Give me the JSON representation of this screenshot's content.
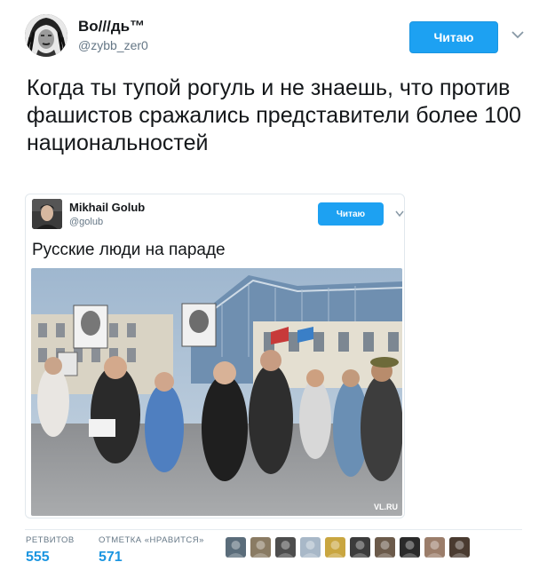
{
  "author": {
    "name": "Во///дь™",
    "handle": "@zybb_zer0",
    "avatar_icon": "warrior-headdress-portrait"
  },
  "follow_button_label": "Читаю",
  "tweet_text": "Когда ты тупой рогуль и не знаешь, что против фашистов сражались представители более 100 национальностей",
  "quoted_tweet": {
    "name": "Mikhail Golub",
    "handle": "@golub",
    "follow_label": "Читаю",
    "text": "Русские люди на параде",
    "photo_watermark": "VL.RU",
    "photo_description": "parade-crowd-holding-portraits"
  },
  "stats": {
    "retweets_label": "РЕТВИТОВ",
    "retweets_value": "555",
    "likes_label": "ОТМЕТКА «НРАВИТСЯ»",
    "likes_value": "571"
  },
  "likers": [
    {
      "color": "#5a6c7a"
    },
    {
      "color": "#8a7b63"
    },
    {
      "color": "#4d4d4d"
    },
    {
      "color": "#a8b8c8"
    },
    {
      "color": "#c9a640"
    },
    {
      "color": "#3c3c3c"
    },
    {
      "color": "#6b5a4a"
    },
    {
      "color": "#2a2a2a"
    },
    {
      "color": "#9b7d6a"
    },
    {
      "color": "#4a3b30"
    }
  ],
  "colors": {
    "accent": "#1da1f2",
    "link": "#1b95e0",
    "muted": "#657786"
  }
}
